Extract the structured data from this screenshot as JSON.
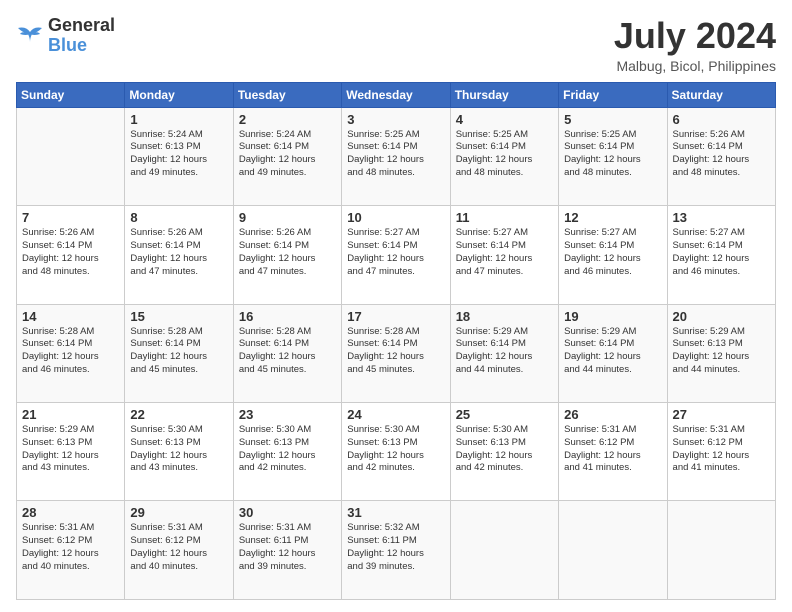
{
  "header": {
    "logo_line1": "General",
    "logo_line2": "Blue",
    "month_year": "July 2024",
    "location": "Malbug, Bicol, Philippines"
  },
  "days_of_week": [
    "Sunday",
    "Monday",
    "Tuesday",
    "Wednesday",
    "Thursday",
    "Friday",
    "Saturday"
  ],
  "weeks": [
    [
      {
        "day": "",
        "text": ""
      },
      {
        "day": "1",
        "text": "Sunrise: 5:24 AM\nSunset: 6:13 PM\nDaylight: 12 hours\nand 49 minutes."
      },
      {
        "day": "2",
        "text": "Sunrise: 5:24 AM\nSunset: 6:14 PM\nDaylight: 12 hours\nand 49 minutes."
      },
      {
        "day": "3",
        "text": "Sunrise: 5:25 AM\nSunset: 6:14 PM\nDaylight: 12 hours\nand 48 minutes."
      },
      {
        "day": "4",
        "text": "Sunrise: 5:25 AM\nSunset: 6:14 PM\nDaylight: 12 hours\nand 48 minutes."
      },
      {
        "day": "5",
        "text": "Sunrise: 5:25 AM\nSunset: 6:14 PM\nDaylight: 12 hours\nand 48 minutes."
      },
      {
        "day": "6",
        "text": "Sunrise: 5:26 AM\nSunset: 6:14 PM\nDaylight: 12 hours\nand 48 minutes."
      }
    ],
    [
      {
        "day": "7",
        "text": "Sunrise: 5:26 AM\nSunset: 6:14 PM\nDaylight: 12 hours\nand 48 minutes."
      },
      {
        "day": "8",
        "text": "Sunrise: 5:26 AM\nSunset: 6:14 PM\nDaylight: 12 hours\nand 47 minutes."
      },
      {
        "day": "9",
        "text": "Sunrise: 5:26 AM\nSunset: 6:14 PM\nDaylight: 12 hours\nand 47 minutes."
      },
      {
        "day": "10",
        "text": "Sunrise: 5:27 AM\nSunset: 6:14 PM\nDaylight: 12 hours\nand 47 minutes."
      },
      {
        "day": "11",
        "text": "Sunrise: 5:27 AM\nSunset: 6:14 PM\nDaylight: 12 hours\nand 47 minutes."
      },
      {
        "day": "12",
        "text": "Sunrise: 5:27 AM\nSunset: 6:14 PM\nDaylight: 12 hours\nand 46 minutes."
      },
      {
        "day": "13",
        "text": "Sunrise: 5:27 AM\nSunset: 6:14 PM\nDaylight: 12 hours\nand 46 minutes."
      }
    ],
    [
      {
        "day": "14",
        "text": "Sunrise: 5:28 AM\nSunset: 6:14 PM\nDaylight: 12 hours\nand 46 minutes."
      },
      {
        "day": "15",
        "text": "Sunrise: 5:28 AM\nSunset: 6:14 PM\nDaylight: 12 hours\nand 45 minutes."
      },
      {
        "day": "16",
        "text": "Sunrise: 5:28 AM\nSunset: 6:14 PM\nDaylight: 12 hours\nand 45 minutes."
      },
      {
        "day": "17",
        "text": "Sunrise: 5:28 AM\nSunset: 6:14 PM\nDaylight: 12 hours\nand 45 minutes."
      },
      {
        "day": "18",
        "text": "Sunrise: 5:29 AM\nSunset: 6:14 PM\nDaylight: 12 hours\nand 44 minutes."
      },
      {
        "day": "19",
        "text": "Sunrise: 5:29 AM\nSunset: 6:14 PM\nDaylight: 12 hours\nand 44 minutes."
      },
      {
        "day": "20",
        "text": "Sunrise: 5:29 AM\nSunset: 6:13 PM\nDaylight: 12 hours\nand 44 minutes."
      }
    ],
    [
      {
        "day": "21",
        "text": "Sunrise: 5:29 AM\nSunset: 6:13 PM\nDaylight: 12 hours\nand 43 minutes."
      },
      {
        "day": "22",
        "text": "Sunrise: 5:30 AM\nSunset: 6:13 PM\nDaylight: 12 hours\nand 43 minutes."
      },
      {
        "day": "23",
        "text": "Sunrise: 5:30 AM\nSunset: 6:13 PM\nDaylight: 12 hours\nand 42 minutes."
      },
      {
        "day": "24",
        "text": "Sunrise: 5:30 AM\nSunset: 6:13 PM\nDaylight: 12 hours\nand 42 minutes."
      },
      {
        "day": "25",
        "text": "Sunrise: 5:30 AM\nSunset: 6:13 PM\nDaylight: 12 hours\nand 42 minutes."
      },
      {
        "day": "26",
        "text": "Sunrise: 5:31 AM\nSunset: 6:12 PM\nDaylight: 12 hours\nand 41 minutes."
      },
      {
        "day": "27",
        "text": "Sunrise: 5:31 AM\nSunset: 6:12 PM\nDaylight: 12 hours\nand 41 minutes."
      }
    ],
    [
      {
        "day": "28",
        "text": "Sunrise: 5:31 AM\nSunset: 6:12 PM\nDaylight: 12 hours\nand 40 minutes."
      },
      {
        "day": "29",
        "text": "Sunrise: 5:31 AM\nSunset: 6:12 PM\nDaylight: 12 hours\nand 40 minutes."
      },
      {
        "day": "30",
        "text": "Sunrise: 5:31 AM\nSunset: 6:11 PM\nDaylight: 12 hours\nand 39 minutes."
      },
      {
        "day": "31",
        "text": "Sunrise: 5:32 AM\nSunset: 6:11 PM\nDaylight: 12 hours\nand 39 minutes."
      },
      {
        "day": "",
        "text": ""
      },
      {
        "day": "",
        "text": ""
      },
      {
        "day": "",
        "text": ""
      }
    ]
  ]
}
